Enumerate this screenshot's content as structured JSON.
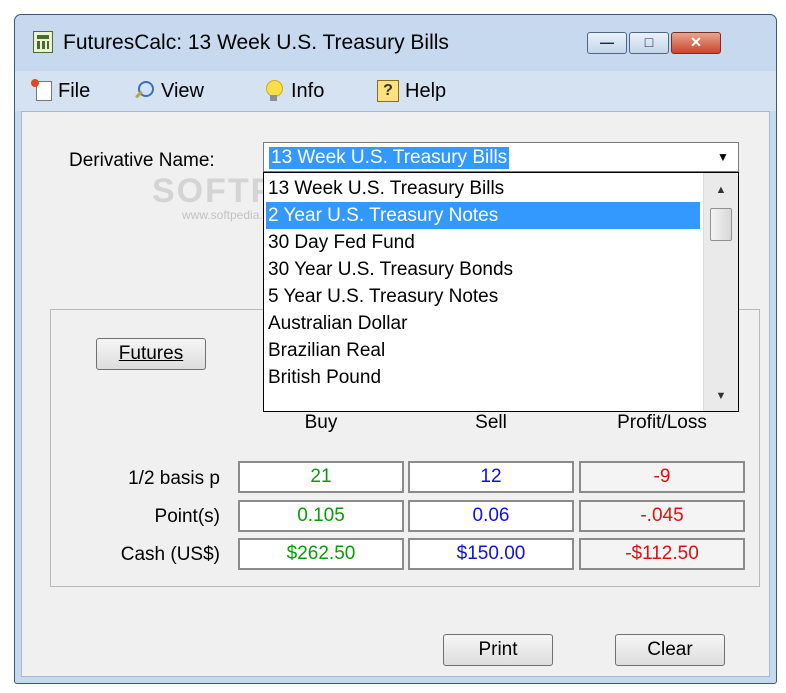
{
  "window": {
    "title": "FuturesCalc: 13 Week U.S. Treasury Bills",
    "minimize_glyph": "—",
    "maximize_glyph": "□",
    "close_glyph": "✕"
  },
  "menu": {
    "file": "File",
    "view": "View",
    "info": "Info",
    "help": "Help"
  },
  "derivative": {
    "label": "Derivative Name:",
    "selected": "13 Week U.S. Treasury Bills",
    "options": [
      "13 Week U.S. Treasury Bills",
      "2 Year U.S. Treasury Notes",
      "30 Day Fed Fund",
      "30 Year U.S. Treasury Bonds",
      "5 Year U.S. Treasury Notes",
      "Australian Dollar",
      "Brazilian Real",
      "British Pound"
    ],
    "highlighted_option": "2 Year U.S. Treasury Notes"
  },
  "watermark": {
    "text": "SOFTPEDIA",
    "url": "www.softpedia.com"
  },
  "calc": {
    "futures_button": "Futures",
    "headers": {
      "buy": "Buy",
      "sell": "Sell",
      "pl": "Profit/Loss"
    },
    "rows": [
      {
        "label": "1/2 basis p",
        "buy": "21",
        "sell": "12",
        "pl": "-9"
      },
      {
        "label": "Point(s)",
        "buy": "0.105",
        "sell": "0.06",
        "pl": "-.045"
      },
      {
        "label": "Cash (US$)",
        "buy": "$262.50",
        "sell": "$150.00",
        "pl": "-$112.50"
      }
    ]
  },
  "actions": {
    "print": "Print",
    "clear": "Clear"
  },
  "colors": {
    "buy": "#0a9a0a",
    "sell": "#1010e0",
    "loss": "#e01010",
    "selection": "#3399ff"
  }
}
